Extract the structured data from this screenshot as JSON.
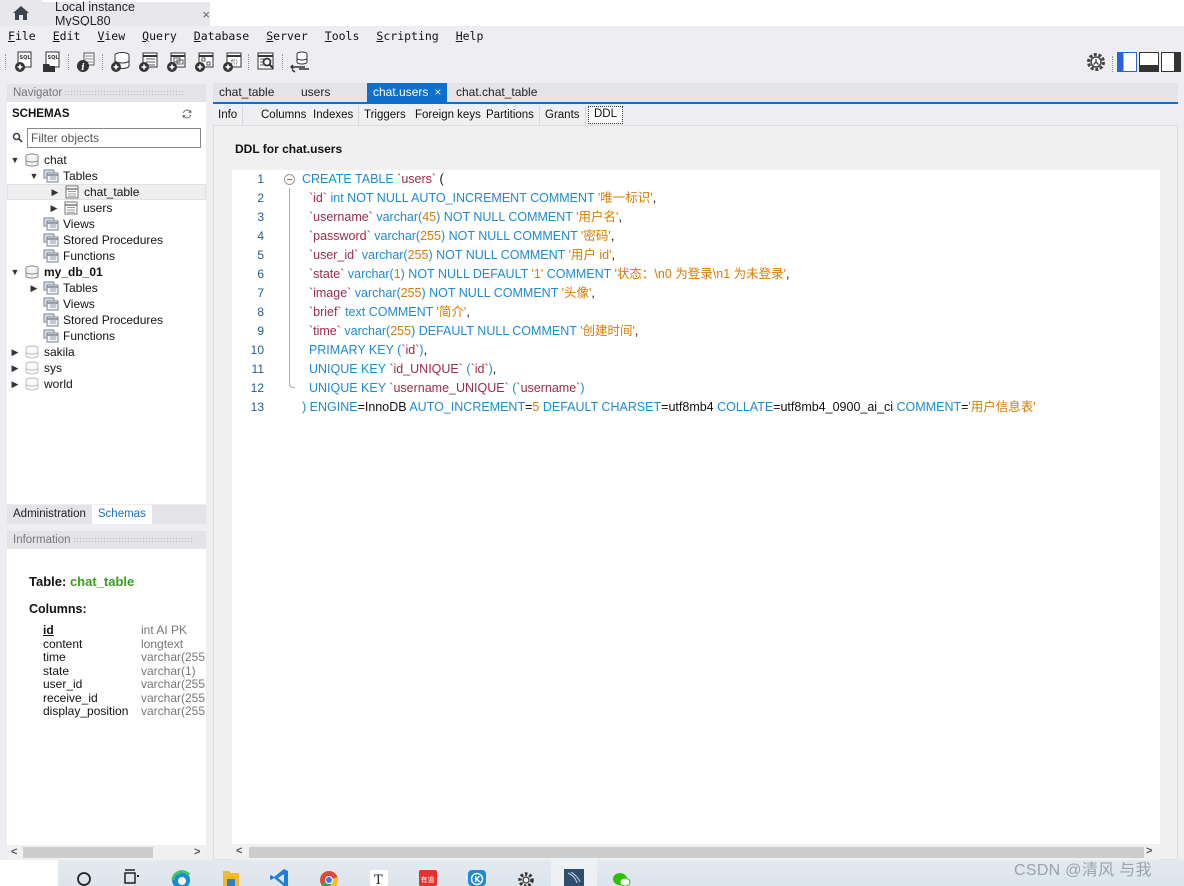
{
  "window": {
    "home_icon": "home-icon",
    "connection_tab": "Local instance MySQL80",
    "close_glyph": "×"
  },
  "menu": [
    {
      "label": "File",
      "mnemonic": "F"
    },
    {
      "label": "Edit",
      "mnemonic": "E"
    },
    {
      "label": "View",
      "mnemonic": "V"
    },
    {
      "label": "Query",
      "mnemonic": "Q"
    },
    {
      "label": "Database",
      "mnemonic": "D"
    },
    {
      "label": "Server",
      "mnemonic": "S"
    },
    {
      "label": "Tools",
      "mnemonic": "T"
    },
    {
      "label": "Scripting",
      "mnemonic": "S"
    },
    {
      "label": "Help",
      "mnemonic": "H"
    }
  ],
  "toolbar": {
    "buttons": [
      "new-sql-tab-icon",
      "open-sql-script-icon",
      "inspector-icon",
      "create-schema-icon",
      "create-table-icon",
      "create-view-icon",
      "create-procedure-icon",
      "create-function-icon",
      "search-table-data-icon",
      "reconnect-icon"
    ],
    "right": [
      "settings-icon",
      "toggle-sidebar-icon",
      "toggle-output-icon",
      "toggle-secondary-sidebar-icon"
    ]
  },
  "navigator": {
    "header": "Navigator",
    "schemas_title": "SCHEMAS",
    "filter_placeholder": "Filter objects",
    "tree": [
      {
        "label": "chat",
        "level": 0,
        "expanded": true,
        "type": "schema",
        "bold": false
      },
      {
        "label": "Tables",
        "level": 1,
        "expanded": true,
        "type": "folder"
      },
      {
        "label": "chat_table",
        "level": 2,
        "expanded": false,
        "type": "table",
        "selected": true
      },
      {
        "label": "users",
        "level": 2,
        "expanded": false,
        "type": "table"
      },
      {
        "label": "Views",
        "level": 1,
        "type": "folder"
      },
      {
        "label": "Stored Procedures",
        "level": 1,
        "type": "folder"
      },
      {
        "label": "Functions",
        "level": 1,
        "type": "folder"
      },
      {
        "label": "my_db_01",
        "level": 0,
        "expanded": true,
        "type": "schema",
        "bold": true
      },
      {
        "label": "Tables",
        "level": 1,
        "expanded": false,
        "type": "folder"
      },
      {
        "label": "Views",
        "level": 1,
        "type": "folder"
      },
      {
        "label": "Stored Procedures",
        "level": 1,
        "type": "folder"
      },
      {
        "label": "Functions",
        "level": 1,
        "type": "folder"
      },
      {
        "label": "sakila",
        "level": 0,
        "expanded": false,
        "type": "schema-gray"
      },
      {
        "label": "sys",
        "level": 0,
        "expanded": false,
        "type": "schema-gray"
      },
      {
        "label": "world",
        "level": 0,
        "expanded": false,
        "type": "schema-gray"
      }
    ],
    "bottom_tabs": [
      {
        "label": "Administration",
        "active": false
      },
      {
        "label": "Schemas",
        "active": true
      }
    ]
  },
  "information": {
    "header": "Information",
    "table_label": "Table:",
    "table_name": "chat_table",
    "columns_label": "Columns:",
    "columns": [
      {
        "name": "id",
        "type": "int AI PK",
        "pk": true
      },
      {
        "name": "content",
        "type": "longtext"
      },
      {
        "name": "time",
        "type": "varchar(255"
      },
      {
        "name": "state",
        "type": "varchar(1)"
      },
      {
        "name": "user_id",
        "type": "varchar(255"
      },
      {
        "name": "receive_id",
        "type": "varchar(255"
      },
      {
        "name": "display_position",
        "type": "varchar(255"
      }
    ]
  },
  "editor": {
    "tabs": [
      {
        "label": "chat_table",
        "active": false
      },
      {
        "label": "users",
        "active": false
      },
      {
        "label": "chat.users",
        "active": true,
        "closable": true
      },
      {
        "label": "chat.chat_table",
        "active": false
      }
    ],
    "subtabs": [
      {
        "label": "Info",
        "active": false
      },
      {
        "label": "Columns",
        "active": false
      },
      {
        "label": "Indexes",
        "active": false
      },
      {
        "label": "Triggers",
        "active": false
      },
      {
        "label": "Foreign keys",
        "active": false
      },
      {
        "label": "Partitions",
        "active": false
      },
      {
        "label": "Grants",
        "active": false
      },
      {
        "label": "DDL",
        "active": true
      }
    ],
    "ddl_title": "DDL for chat.users",
    "lines": [
      [
        [
          "kw",
          "CREATE TABLE "
        ],
        [
          "id",
          "`users`"
        ],
        [
          "pl",
          " ("
        ]
      ],
      [
        [
          "pl",
          "  "
        ],
        [
          "id",
          "`id`"
        ],
        [
          "kw",
          " int NOT NULL AUTO_INCREMENT COMMENT "
        ],
        [
          "str",
          "'唯一标识'"
        ],
        [
          "pl",
          ","
        ]
      ],
      [
        [
          "pl",
          "  "
        ],
        [
          "id",
          "`username`"
        ],
        [
          "kw",
          " varchar("
        ],
        [
          "num",
          "45"
        ],
        [
          "kw",
          ") NOT NULL COMMENT "
        ],
        [
          "str",
          "'用户名'"
        ],
        [
          "pl",
          ","
        ]
      ],
      [
        [
          "pl",
          "  "
        ],
        [
          "id",
          "`password`"
        ],
        [
          "kw",
          " varchar("
        ],
        [
          "num",
          "255"
        ],
        [
          "kw",
          ") NOT NULL COMMENT "
        ],
        [
          "str",
          "'密码'"
        ],
        [
          "pl",
          ","
        ]
      ],
      [
        [
          "pl",
          "  "
        ],
        [
          "id",
          "`user_id`"
        ],
        [
          "kw",
          " varchar("
        ],
        [
          "num",
          "255"
        ],
        [
          "kw",
          ") NOT NULL COMMENT "
        ],
        [
          "str",
          "'用户 id'"
        ],
        [
          "pl",
          ","
        ]
      ],
      [
        [
          "pl",
          "  "
        ],
        [
          "id",
          "`state`"
        ],
        [
          "kw",
          " varchar("
        ],
        [
          "num",
          "1"
        ],
        [
          "kw",
          ") NOT NULL DEFAULT "
        ],
        [
          "str",
          "'1'"
        ],
        [
          "kw",
          " COMMENT "
        ],
        [
          "str",
          "'状态：\\n0 为登录\\n1 为未登录'"
        ],
        [
          "pl",
          ","
        ]
      ],
      [
        [
          "pl",
          "  "
        ],
        [
          "id",
          "`image`"
        ],
        [
          "kw",
          " varchar("
        ],
        [
          "num",
          "255"
        ],
        [
          "kw",
          ") NOT NULL COMMENT "
        ],
        [
          "str",
          "'头像'"
        ],
        [
          "pl",
          ","
        ]
      ],
      [
        [
          "pl",
          "  "
        ],
        [
          "id",
          "`brief`"
        ],
        [
          "kw",
          " text COMMENT "
        ],
        [
          "str",
          "'简介'"
        ],
        [
          "pl",
          ","
        ]
      ],
      [
        [
          "pl",
          "  "
        ],
        [
          "id",
          "`time`"
        ],
        [
          "kw",
          " varchar("
        ],
        [
          "num",
          "255"
        ],
        [
          "kw",
          ") DEFAULT NULL COMMENT "
        ],
        [
          "str",
          "'创建时间'"
        ],
        [
          "pl",
          ","
        ]
      ],
      [
        [
          "kw",
          "  PRIMARY KEY ("
        ],
        [
          "id",
          "`id`"
        ],
        [
          "kw",
          ")"
        ],
        [
          "pl",
          ","
        ]
      ],
      [
        [
          "kw",
          "  UNIQUE KEY "
        ],
        [
          "id",
          "`id_UNIQUE`"
        ],
        [
          "kw",
          " ("
        ],
        [
          "id",
          "`id`"
        ],
        [
          "kw",
          ")"
        ],
        [
          "pl",
          ","
        ]
      ],
      [
        [
          "kw",
          "  UNIQUE KEY "
        ],
        [
          "id",
          "`username_UNIQUE`"
        ],
        [
          "kw",
          " ("
        ],
        [
          "id",
          "`username`"
        ],
        [
          "kw",
          ")"
        ]
      ],
      [
        [
          "kw",
          ") ENGINE"
        ],
        [
          "pl",
          "=InnoDB "
        ],
        [
          "kw",
          "AUTO_INCREMENT"
        ],
        [
          "pl",
          "="
        ],
        [
          "num",
          "5"
        ],
        [
          "kw",
          " DEFAULT CHARSET"
        ],
        [
          "pl",
          "=utf8mb4 "
        ],
        [
          "kw",
          "COLLATE"
        ],
        [
          "pl",
          "=utf8mb4_0900_ai_ci "
        ],
        [
          "kw",
          "COMMENT"
        ],
        [
          "pl",
          "="
        ],
        [
          "str",
          "'用户信息表'"
        ]
      ]
    ]
  },
  "taskbar": {
    "apps": [
      "search-icon",
      "task-view-icon",
      "edge-icon",
      "file-explorer-icon",
      "vscode-icon",
      "chrome-icon",
      "typora-icon",
      "youdao-icon",
      "kugou-icon",
      "settings-icon",
      "mysql-workbench-icon",
      "wechat-icon"
    ]
  },
  "watermark": "CSDN @清风 与我",
  "colors": {
    "accent": "#0e6fcd",
    "keyword": "#1f8ad0",
    "identifier": "#9a2b4a",
    "string": "#d87a00",
    "table_name_green": "#3c9a1e"
  }
}
